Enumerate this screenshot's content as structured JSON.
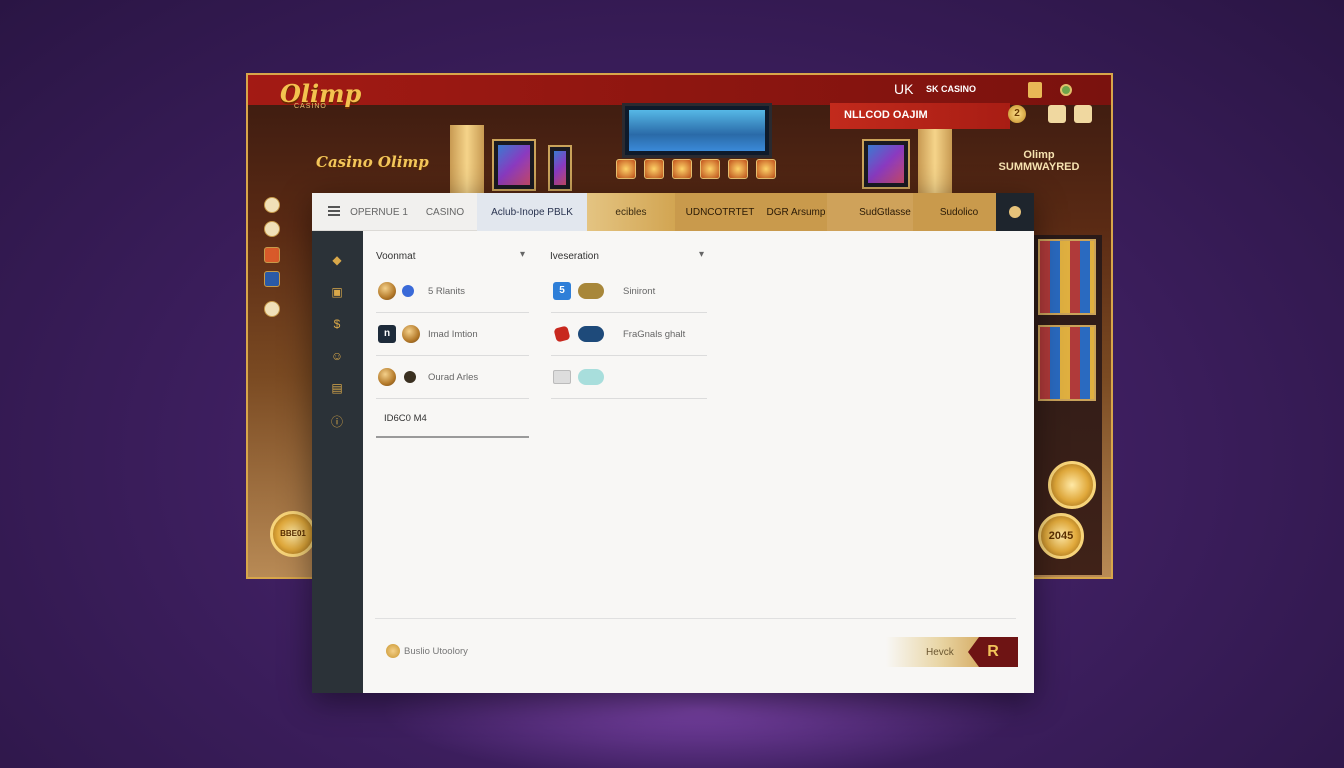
{
  "casino": {
    "logo": "Olimp",
    "logo_sub": "CASINO",
    "region": "UK",
    "brand_tag": "SK CASINO",
    "promo": "NLLCOD OAJIM",
    "coin_badge": "2",
    "sign_left": "Casino Olimp",
    "sign_right": "Olimp SUMMWAYRED",
    "coin_top_label": "",
    "coin_bottom_label": "2045",
    "coin_left_label": "BBE01"
  },
  "app": {
    "tabs": [
      {
        "label": "OPERNUE  1"
      },
      {
        "label": "CASINO"
      },
      {
        "label": "Aclub-Inope PBLK"
      },
      {
        "label": "ecibles"
      },
      {
        "label": "UDNCOTRTET"
      },
      {
        "label": "DGR Arsump"
      },
      {
        "label": "SudGtlasse"
      },
      {
        "label": "Sudolico"
      }
    ],
    "sidebar_icons": [
      "diamond-icon",
      "chip-icon",
      "coins-icon",
      "smile-icon",
      "card-icon",
      "alert-icon"
    ],
    "columns": [
      {
        "header": "Voonmat",
        "rows": [
          {
            "label": "5 Rlanits"
          },
          {
            "label": "Imad Imtion"
          },
          {
            "label": "Ourad Arles"
          }
        ],
        "input_value": "ID6C0 M4"
      },
      {
        "header": "Iveseration",
        "rows": [
          {
            "label": "Siniront"
          },
          {
            "label": "FraGnals ghalt"
          },
          {
            "label": ""
          }
        ]
      }
    ],
    "footer": {
      "link": "Buslio Utoolory",
      "cta_label": "Hevck",
      "cta_button": "R"
    }
  },
  "colors": {
    "panel_bg": "#f8f7f5",
    "sidebar": "#2b3238",
    "gold": "#d9a84a",
    "red_top": "#a31a14",
    "background": "#3e1f60"
  }
}
